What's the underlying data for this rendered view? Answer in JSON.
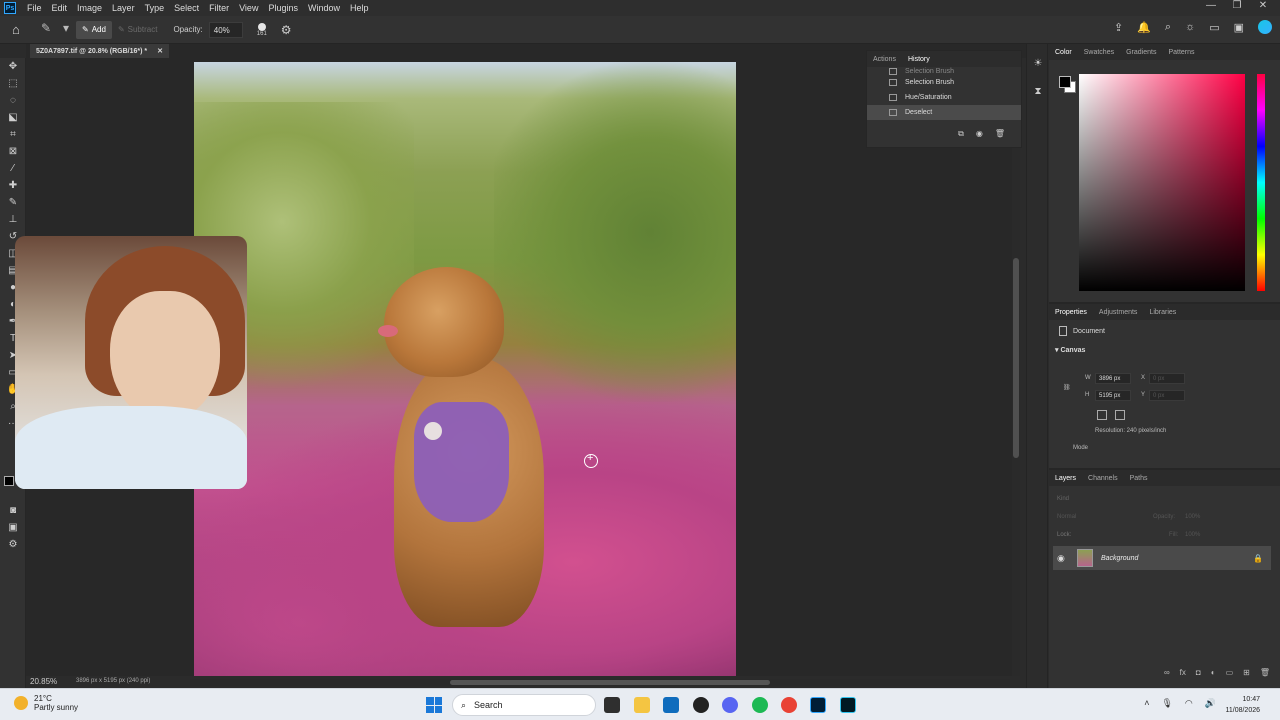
{
  "menu": {
    "logo": "Ps",
    "items": [
      "File",
      "Edit",
      "Image",
      "Layer",
      "Type",
      "Select",
      "Filter",
      "View",
      "Plugins",
      "Window",
      "Help"
    ]
  },
  "options": {
    "add_label": "Add",
    "subtract_label": "Subtract",
    "opacity_label": "Opacity:",
    "opacity_value": "40%",
    "brush_size": "161"
  },
  "document": {
    "tab_title": "5Z0A7897.tif @ 20.8% (RGB/16*) *",
    "zoom": "20.85%",
    "size_info": "3896 px x 5195 px (240 ppi)"
  },
  "history": {
    "tabs": [
      "Actions",
      "History"
    ],
    "active_tab": "History",
    "items": [
      "Selection Brush",
      "Selection Brush",
      "Hue/Saturation",
      "Deselect"
    ],
    "selected": "Deselect"
  },
  "color_panel": {
    "tabs": [
      "Color",
      "Swatches",
      "Gradients",
      "Patterns"
    ],
    "active_tab": "Color",
    "hue_color": "#ff0045"
  },
  "properties": {
    "tabs": [
      "Properties",
      "Adjustments",
      "Libraries"
    ],
    "active_tab": "Properties",
    "type": "Document",
    "section": "Canvas",
    "w_label": "W",
    "w_value": "3896 px",
    "h_label": "H",
    "h_value": "5195 px",
    "x_label": "X",
    "x_value": "0 px",
    "y_label": "Y",
    "y_value": "0 px",
    "resolution": "Resolution: 240 pixels/inch",
    "mode_label": "Mode"
  },
  "layers": {
    "tabs": [
      "Layers",
      "Channels",
      "Paths"
    ],
    "active_tab": "Layers",
    "kind_placeholder": "Kind",
    "blend_mode": "Normal",
    "opacity_label": "Opacity:",
    "opacity_value": "100%",
    "lock_label": "Lock:",
    "fill_label": "Fill:",
    "fill_value": "100%",
    "layer_name": "Background"
  },
  "taskbar": {
    "temp": "21°C",
    "condition": "Partly sunny",
    "search": "Search",
    "time": "10:47",
    "date": "11/08/2026"
  }
}
